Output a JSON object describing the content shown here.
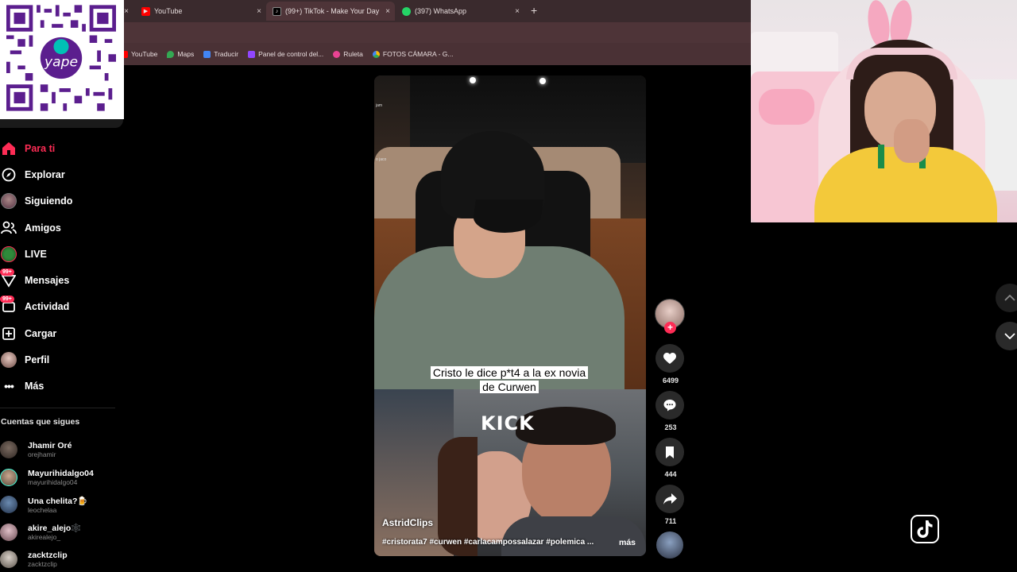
{
  "browser": {
    "tabs": [
      {
        "label": "YouTube",
        "icon": "youtube-icon"
      },
      {
        "label": "(99+) TikTok - Make Your Day",
        "icon": "tiktok-icon"
      },
      {
        "label": "(397) WhatsApp",
        "icon": "whatsapp-icon"
      }
    ],
    "new_tab": "+",
    "close": "×",
    "bookmarks": [
      {
        "label": "YouTube",
        "color": "#ff0000"
      },
      {
        "label": "Maps",
        "color": "#34a853"
      },
      {
        "label": "Traducir",
        "color": "#4285f4"
      },
      {
        "label": "Panel de control del...",
        "color": "#9146ff"
      },
      {
        "label": "Ruleta",
        "color": "#e84393"
      },
      {
        "label": "FOTOS CÁMARA - G...",
        "color": "#fbbc04"
      }
    ]
  },
  "overlay": {
    "qr_brand": "yape"
  },
  "sidebar": {
    "nav": [
      {
        "label": "Para ti",
        "icon": "home-icon",
        "active": true
      },
      {
        "label": "Explorar",
        "icon": "compass-icon"
      },
      {
        "label": "Siguiendo",
        "icon": "following-avatar"
      },
      {
        "label": "Amigos",
        "icon": "friends-icon"
      },
      {
        "label": "LIVE",
        "icon": "live-icon"
      },
      {
        "label": "Mensajes",
        "icon": "messages-icon",
        "badge": "99+"
      },
      {
        "label": "Actividad",
        "icon": "activity-icon",
        "badge": "99+"
      },
      {
        "label": "Cargar",
        "icon": "upload-icon"
      },
      {
        "label": "Perfil",
        "icon": "profile-avatar"
      },
      {
        "label": "Más",
        "icon": "more-icon"
      }
    ],
    "following_title": "Cuentas que sigues",
    "accounts": [
      {
        "name": "Jhamir Oré",
        "handle": "orejhamir"
      },
      {
        "name": "Mayurihidalgo04",
        "handle": "mayurihidalgo04"
      },
      {
        "name": "Una chelita?🍺",
        "handle": "leochelaa"
      },
      {
        "name": "akire_alejo🕸️",
        "handle": "akirealejo_"
      },
      {
        "name": "zacktzclip",
        "handle": "zacktzclip"
      }
    ]
  },
  "video": {
    "caption": "Cristo le dice p*t4 a la ex novia de Curwen",
    "overlay_label": "KICK",
    "author": "AstridClips",
    "description": "#cristorata7 #curwen #carlacampossalazar #polemica ...",
    "more": "más"
  },
  "actions": {
    "likes": "6499",
    "comments": "253",
    "saves": "444",
    "shares": "711"
  },
  "colors": {
    "accent": "#fe2c55",
    "chrome": "#4e3438"
  }
}
